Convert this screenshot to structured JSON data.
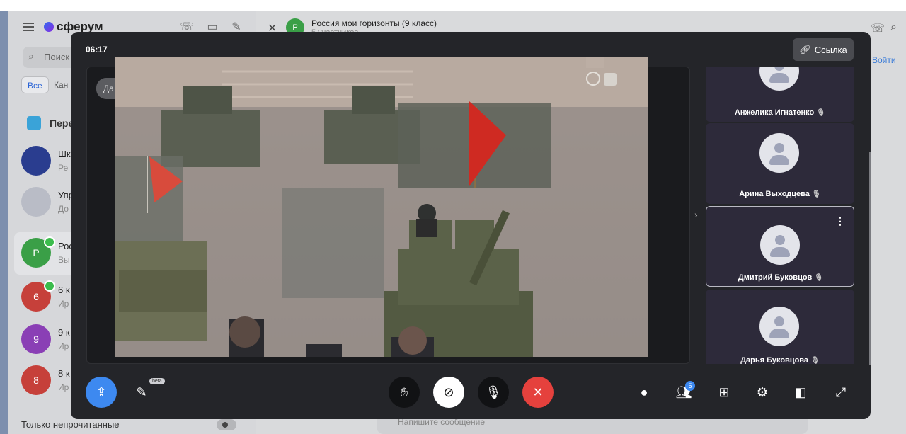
{
  "app": {
    "logo": "сферум",
    "search_placeholder": "Поиск",
    "filters": [
      "Все",
      "Кан"
    ],
    "section_title": "Пере",
    "chats": [
      {
        "name": "Шк",
        "sub": "Ре",
        "avatar": "",
        "color": "#2a3d8f"
      },
      {
        "name": "Упр",
        "sub": "До",
        "avatar": "",
        "color": "#b9bcc6"
      },
      {
        "name": "Рос",
        "sub": "Вы",
        "avatar": "Р",
        "color": "#3a9f47"
      },
      {
        "name": "6 к",
        "sub": "Ир",
        "avatar": "6",
        "color": "#c6403a"
      },
      {
        "name": "9 к",
        "sub": "Ир",
        "avatar": "9",
        "color": "#8a3fb5"
      },
      {
        "name": "8 к",
        "sub": "Ир",
        "avatar": "8",
        "color": "#c6403a"
      }
    ],
    "unread_only": "Только непрочитанные",
    "chat_header": {
      "avatar": "Р",
      "title": "Россия мои горизонты (9 класс)",
      "subtitle": "5 участников"
    },
    "join_label": "Войти",
    "composer_placeholder": "Напишите сообщение"
  },
  "call": {
    "timer": "06:17",
    "link_label": "Ссылка",
    "speaker_chip": "Да",
    "participants": [
      {
        "name": "Анжелика Игнатенко",
        "active": false
      },
      {
        "name": "Арина Выходцева",
        "active": false
      },
      {
        "name": "Дмитрий Буковцов",
        "active": true
      },
      {
        "name": "Дарья Буковцова",
        "active": false
      }
    ],
    "controls": {
      "share_icon": "screen-share-icon",
      "effects_icon": "effects-icon",
      "beta_label": "beta",
      "hand_icon": "raise-hand-icon",
      "camera_icon": "camera-off-icon",
      "mic_icon": "microphone-icon",
      "end_icon": "end-call-icon",
      "chat_icon": "chat-icon",
      "participants_icon": "participants-icon",
      "participants_count": "5",
      "grid_icon": "grid-icon",
      "settings_icon": "gear-icon",
      "pip_icon": "picture-in-picture-icon",
      "fullscreen_icon": "fullscreen-icon"
    },
    "colors": {
      "accent": "#3d89f0",
      "end": "#e5413d",
      "panel": "#242529"
    }
  }
}
